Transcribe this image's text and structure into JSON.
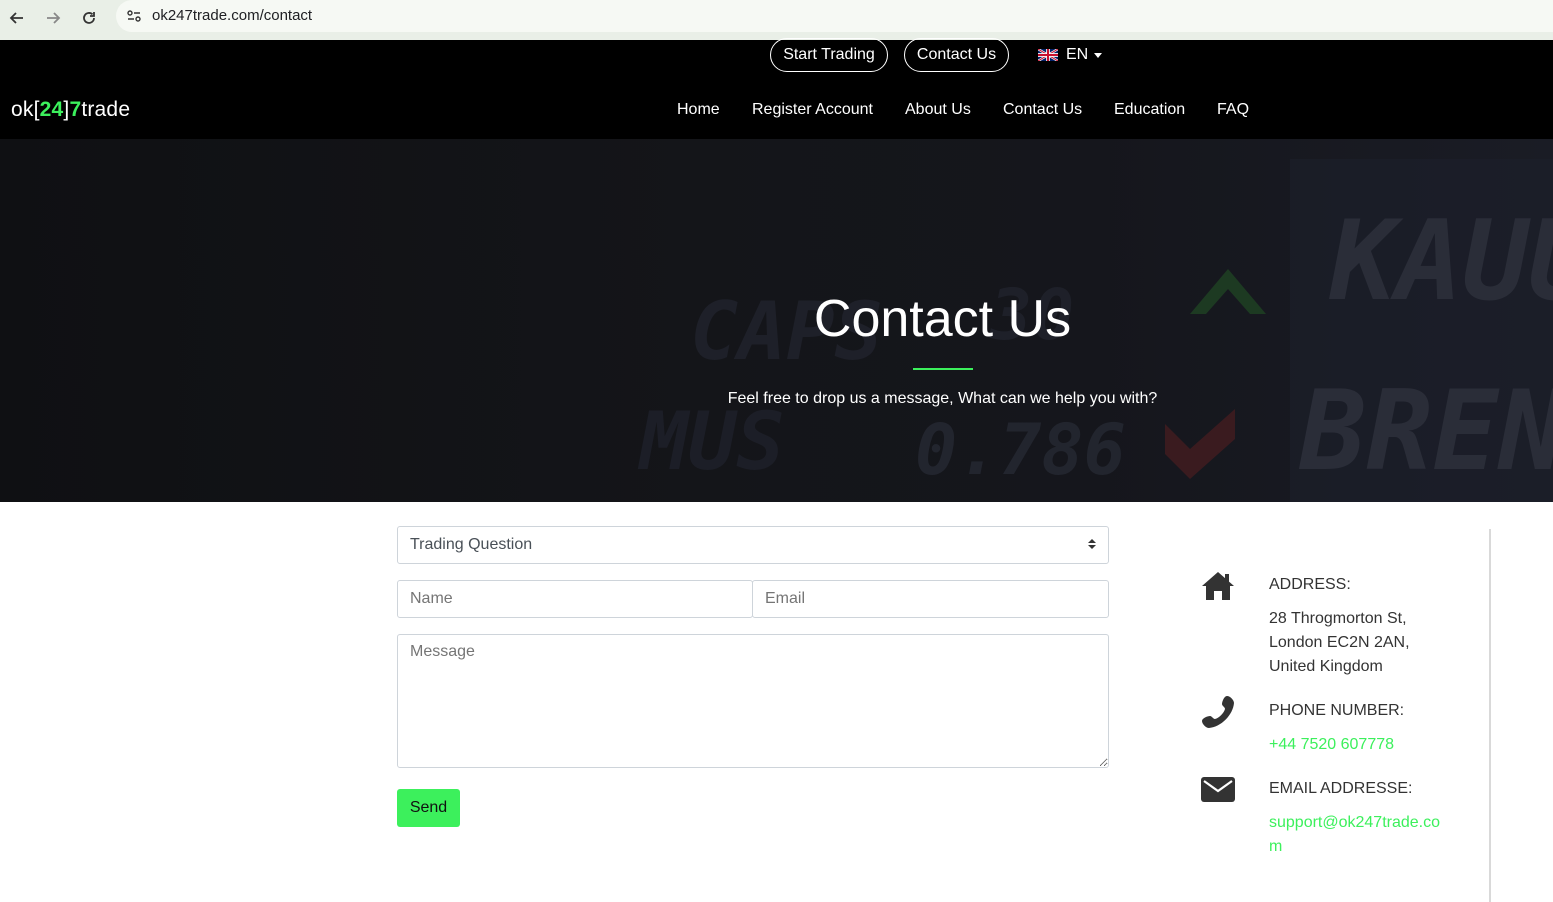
{
  "browser": {
    "url": "ok247trade.com/contact"
  },
  "header": {
    "top_buttons": [
      "Start Trading",
      "Contact Us"
    ],
    "language": "EN",
    "logo": {
      "prefix": "ok[",
      "num1": "24",
      "mid": "]",
      "num2": "7",
      "suffix": "trade"
    },
    "nav": [
      "Home",
      "Register Account",
      "About Us",
      "Contact Us",
      "Education",
      "FAQ"
    ]
  },
  "hero": {
    "title": "Contact Us",
    "subtitle": "Feel free to drop us a message, What can we help you with?"
  },
  "form": {
    "topic_selected": "Trading Question",
    "name_placeholder": "Name",
    "email_placeholder": "Email",
    "message_placeholder": "Message",
    "send_label": "Send"
  },
  "contact": {
    "address_label": "ADDRESS:",
    "address_lines": [
      "28 Throgmorton St,",
      "London EC2N 2AN,",
      "United Kingdom"
    ],
    "phone_label": "PHONE NUMBER:",
    "phone": "+44 7520 607778",
    "email_label": "EMAIL ADDRESSE:",
    "email_lines": [
      "support@ok247trade.co",
      "m"
    ]
  },
  "colors": {
    "accent": "#3cf05c",
    "header_bg": "#000000",
    "hero_bg": "#141519"
  }
}
